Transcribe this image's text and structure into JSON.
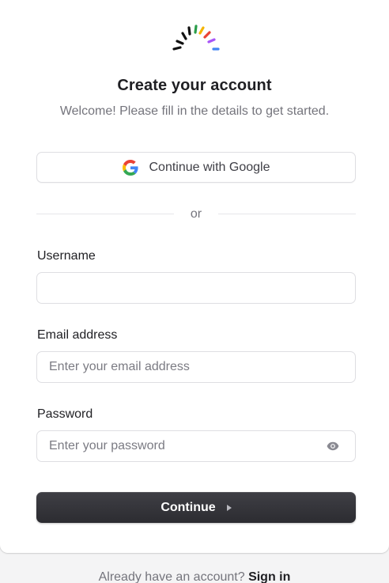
{
  "header": {
    "title": "Create your account",
    "subtitle": "Welcome! Please fill in the details to get started."
  },
  "social": {
    "google_label": "Continue with Google",
    "icon": "google-icon"
  },
  "divider": {
    "label": "or"
  },
  "form": {
    "username": {
      "label": "Username",
      "value": "",
      "placeholder": ""
    },
    "email": {
      "label": "Email address",
      "value": "",
      "placeholder": "Enter your email address"
    },
    "password": {
      "label": "Password",
      "value": "",
      "placeholder": "Enter your password",
      "toggle_icon": "eye-icon"
    },
    "submit_label": "Continue",
    "submit_icon": "triangle-right-icon"
  },
  "footer": {
    "prompt": "Already have an account?",
    "link": "Sign in"
  },
  "colors": {
    "primary_button": "#2f2f34",
    "text_primary": "#1f1f23",
    "text_secondary": "#74747c",
    "border": "#dedee2",
    "logo": [
      "#111111",
      "#111111",
      "#111111",
      "#2a9d4a",
      "#f4b400",
      "#ea4335",
      "#a855f7",
      "#4285f4"
    ]
  }
}
